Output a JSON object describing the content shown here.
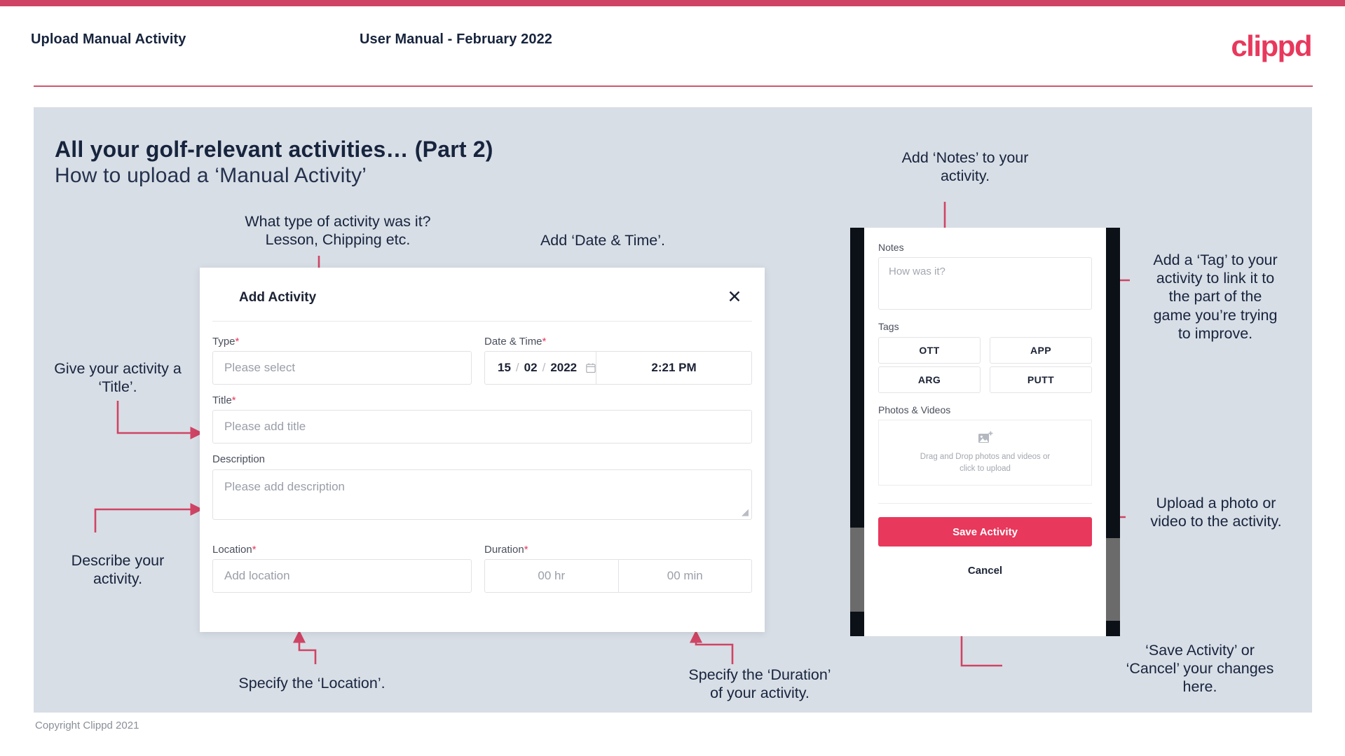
{
  "theme": {
    "accent_pink": "#e8385c",
    "accent_bar": "#cf4464",
    "slide_bg": "#d8dee6",
    "ink": "#17243d",
    "arrow": "#cf4464"
  },
  "header": {
    "left_title": "Upload Manual Activity",
    "center_title": "User Manual - February 2022",
    "logo": "clippd"
  },
  "slide": {
    "title": "All your golf-relevant activities… (Part 2)",
    "subtitle": "How to upload a ‘Manual Activity’"
  },
  "footer": {
    "copyright": "Copyright Clippd 2021"
  },
  "annotations": [
    {
      "id": "type",
      "text": "What type of activity was it?\nLesson, Chipping etc."
    },
    {
      "id": "datetime",
      "text": "Add ‘Date & Time’."
    },
    {
      "id": "title",
      "text": "Give your activity a\n‘Title’."
    },
    {
      "id": "describe",
      "text": "Describe your\nactivity."
    },
    {
      "id": "location",
      "text": "Specify the ‘Location’."
    },
    {
      "id": "duration",
      "text": "Specify the ‘Duration’\nof your activity."
    },
    {
      "id": "notes",
      "text": "Add ‘Notes’ to your\nactivity."
    },
    {
      "id": "tag",
      "text": "Add a ‘Tag’ to your\nactivity to link it to\nthe part of the\ngame you’re trying\nto improve."
    },
    {
      "id": "upload",
      "text": "Upload a photo or\nvideo to the activity."
    },
    {
      "id": "savecancel",
      "text": "‘Save Activity’ or\n‘Cancel’ your changes\nhere."
    }
  ],
  "dialog": {
    "title": "Add Activity",
    "close_icon": "close-icon",
    "fields": {
      "type": {
        "label": "Type",
        "required_mark": "*",
        "placeholder": "Please select",
        "caret_icon": "chevron-down-icon"
      },
      "datetime": {
        "label": "Date & Time",
        "required_mark": "*",
        "day": "15",
        "month": "02",
        "year": "2022",
        "separator": "/",
        "calendar_icon": "calendar-icon",
        "time": "2:21 PM"
      },
      "title": {
        "label": "Title",
        "required_mark": "*",
        "placeholder": "Please add title"
      },
      "description": {
        "label": "Description",
        "required_mark": "",
        "placeholder": "Please add description",
        "resize_grip": "resize-grip-icon"
      },
      "location": {
        "label": "Location",
        "required_mark": "*",
        "placeholder": "Add location"
      },
      "duration": {
        "label": "Duration",
        "required_mark": "*",
        "hours_placeholder": "00 hr",
        "minutes_placeholder": "00 min"
      }
    }
  },
  "phone": {
    "notes": {
      "label": "Notes",
      "placeholder": "How was it?"
    },
    "tags": {
      "label": "Tags",
      "items": [
        "OTT",
        "APP",
        "ARG",
        "PUTT"
      ]
    },
    "photos": {
      "label": "Photos & Videos",
      "icon": "add-image-icon",
      "line1": "Drag and Drop photos and videos or",
      "line2": "click to upload"
    },
    "save_label": "Save Activity",
    "cancel_label": "Cancel"
  }
}
